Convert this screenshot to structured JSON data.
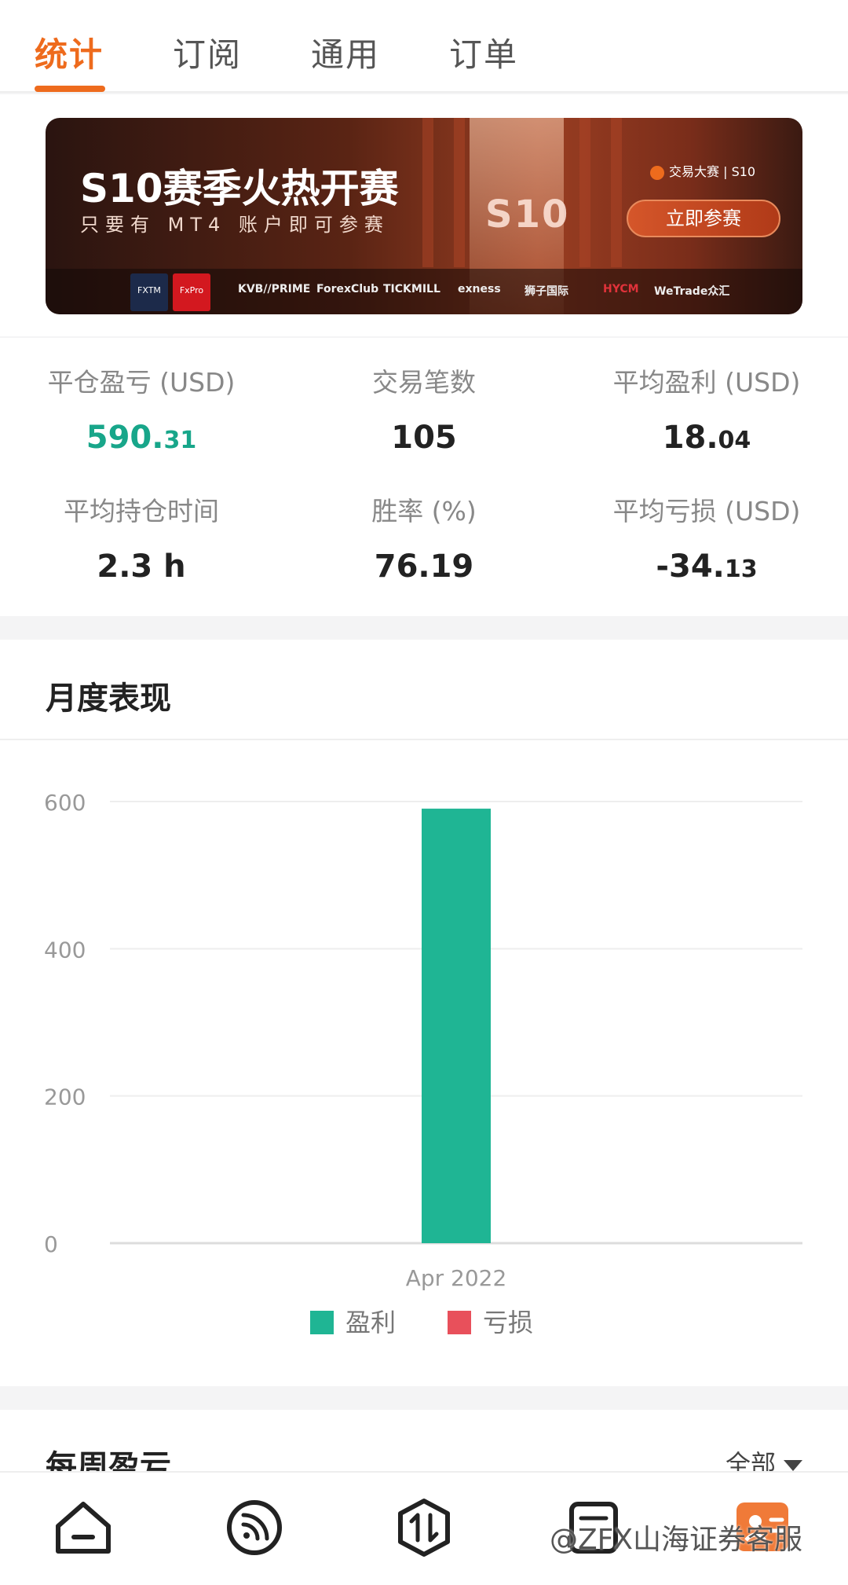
{
  "tabs": [
    {
      "label": "统计",
      "active": true
    },
    {
      "label": "订阅",
      "active": false
    },
    {
      "label": "通用",
      "active": false
    },
    {
      "label": "订单",
      "active": false
    }
  ],
  "banner": {
    "title": "S10赛季火热开赛",
    "subtitle": "只要有 MT4 账户即可参赛",
    "brand": "交易大赛 | S10",
    "s10": "S10",
    "cta": "立即参赛",
    "logos": [
      "FXTM",
      "FxPro",
      "KVB//PRIME",
      "ForexClub",
      "TICKMILL",
      "exness",
      "狮子国际",
      "HYCM",
      "WeTrade众汇"
    ]
  },
  "stats": [
    {
      "label": "平仓盈亏 (USD)",
      "int": "590.",
      "dec": "31",
      "color": "#18a68a"
    },
    {
      "label": "交易笔数",
      "int": "105",
      "dec": "",
      "color": "#222222"
    },
    {
      "label": "平均盈利 (USD)",
      "int": "18.",
      "dec": "04",
      "color": "#222222"
    },
    {
      "label": "平均持仓时间",
      "int": "2.3 h",
      "dec": "",
      "color": "#222222"
    },
    {
      "label": "胜率 (%)",
      "int": "76.19",
      "dec": "",
      "color": "#222222"
    },
    {
      "label": "平均亏损 (USD)",
      "int": "-34.",
      "dec": "13",
      "color": "#222222"
    }
  ],
  "monthly": {
    "title": "月度表现"
  },
  "chart_data": {
    "type": "bar",
    "categories": [
      "Apr 2022"
    ],
    "series": [
      {
        "name": "盈利",
        "values": [
          590.31
        ],
        "color": "#1fb594"
      },
      {
        "name": "亏损",
        "values": [
          0
        ],
        "color": "#e8505b"
      }
    ],
    "yticks": [
      0,
      200,
      400,
      600
    ],
    "ylim": [
      0,
      600
    ],
    "grid": true,
    "legend": "bottom-center"
  },
  "weekly": {
    "title": "每周盈亏",
    "filter": "全部"
  },
  "nav": [
    "home-icon",
    "feed-icon",
    "trade-icon",
    "orders-icon",
    "profile-icon"
  ],
  "watermark": "@ZFX山海证券客服"
}
